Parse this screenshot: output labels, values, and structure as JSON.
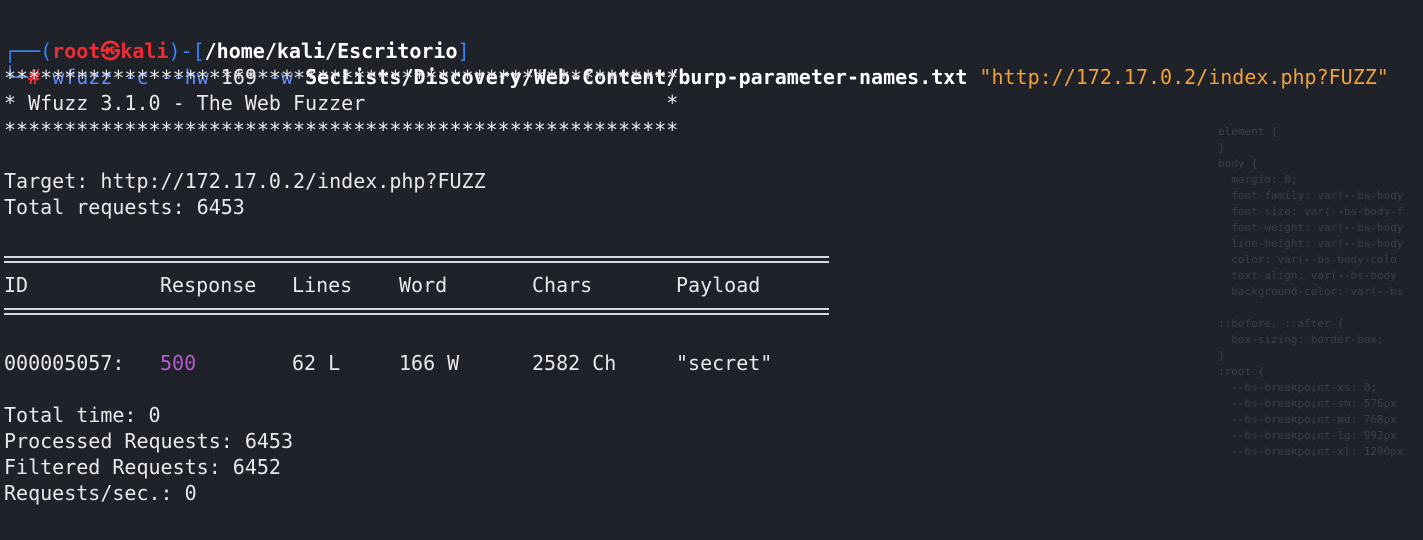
{
  "prompt": {
    "bracket_open": "┌──(",
    "user": "root",
    "at_icon": "㉿",
    "host": "kali",
    "bracket_mid": ")-[",
    "path": "/home/kali/Escritorio",
    "bracket_close": "]",
    "second_line_prefix": "└─",
    "hash": "#"
  },
  "command": {
    "program": "wfuzz",
    "flags1": "-c --hw",
    "hw_value": "169",
    "flag_w": "-w",
    "wordlist": "SecLists/Discovery/Web-Content/burp-parameter-names.txt",
    "url": "\"http://172.17.0.2/index.php?FUZZ\""
  },
  "banner": {
    "stars": "********************************************************",
    "title": "* Wfuzz 3.1.0 - The Web Fuzzer                         *"
  },
  "info": {
    "target": "Target: http://172.17.0.2/index.php?FUZZ",
    "total_requests": "Total requests: 6453"
  },
  "table": {
    "headers": [
      "ID",
      "Response",
      "Lines",
      "Word",
      "Chars",
      "Payload"
    ],
    "rows": [
      [
        "000005057:",
        "500",
        "62 L",
        "166 W",
        "2582 Ch",
        "\"secret\""
      ]
    ]
  },
  "summary": {
    "total_time": "Total time: 0",
    "processed": "Processed Requests: 6453",
    "filtered": "Filtered Requests: 6452",
    "rate": "Requests/sec.: 0"
  },
  "colors": {
    "background": "#1f2229",
    "prompt_blue": "#3b82f6",
    "root_red": "#ef2b34",
    "string_orange": "#f0a13c",
    "status_purple": "#b55ad0"
  }
}
